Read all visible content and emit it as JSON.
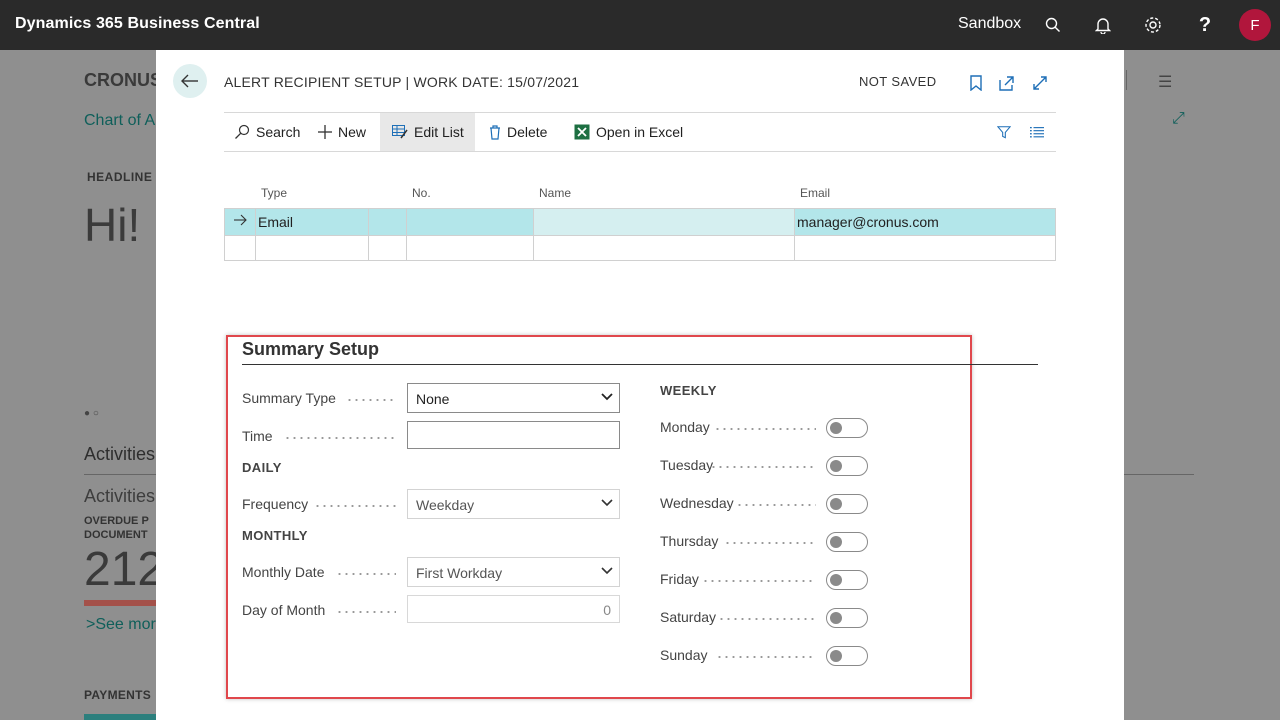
{
  "topbar": {
    "app_title": "Dynamics 365 Business Central",
    "environment": "Sandbox",
    "icons": [
      "search-icon",
      "bell-icon",
      "gear-icon",
      "help-icon"
    ],
    "avatar_initial": "F",
    "avatar_color": "#b1163c"
  },
  "background": {
    "company": "CRONUS",
    "chart_link": "Chart of A",
    "headline_label": "HEADLINE",
    "greeting": "Hi!",
    "activities_heading": "Activities",
    "activities_sub": "Activities",
    "overdue_label": "OVERDUE P\nDOCUMENT",
    "overdue_count": "212",
    "see_more": "See mor",
    "payments_heading": "PAYMENTS"
  },
  "dialog": {
    "title": "ALERT RECIPIENT SETUP | WORK DATE: 15/07/2021",
    "status": "NOT SAVED",
    "actions": {
      "search": "Search",
      "new": "New",
      "edit_list": "Edit List",
      "delete": "Delete",
      "open_excel": "Open in Excel"
    },
    "grid": {
      "columns": {
        "type": "Type",
        "no": "No.",
        "name": "Name",
        "email": "Email"
      },
      "rows": [
        {
          "type": "Email",
          "no": "",
          "name": "",
          "email": "manager@cronus.com"
        }
      ]
    },
    "summary": {
      "title": "Summary Setup",
      "summary_type_label": "Summary Type",
      "summary_type_value": "None",
      "time_label": "Time",
      "time_value": "",
      "daily_group": "DAILY",
      "frequency_label": "Frequency",
      "frequency_value": "Weekday",
      "monthly_group": "MONTHLY",
      "monthly_date_label": "Monthly Date",
      "monthly_date_value": "First Workday",
      "day_of_month_label": "Day of Month",
      "day_of_month_value": "0",
      "weekly_group": "WEEKLY",
      "days": [
        "Monday",
        "Tuesday",
        "Wednesday",
        "Thursday",
        "Friday",
        "Saturday",
        "Sunday"
      ],
      "days_enabled": [
        false,
        false,
        false,
        false,
        false,
        false,
        false
      ]
    }
  },
  "colors": {
    "accent": "#0f5f5a",
    "selected_row": "#b3e6ea",
    "highlight_frame": "#e0474c"
  }
}
